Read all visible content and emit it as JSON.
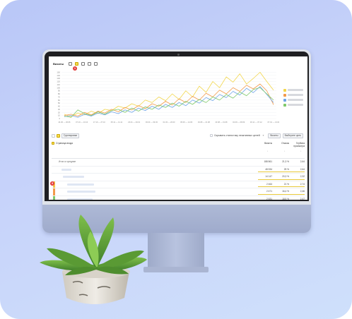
{
  "screen": {
    "title": "Визиты",
    "badge_chart": "1",
    "badge_table": "3",
    "controls": {
      "groupings": "Группировки",
      "hide_bots": "Скрывать статистику неактивных целей",
      "visits_btn": "Визиты",
      "choose_btn": "Выберите цель"
    },
    "table": {
      "dimension_header": "Страница входа",
      "metric_headers": [
        "Визиты",
        "Отказы",
        "Глубина просмотра"
      ],
      "sort_marks": [
        "↓",
        "↓",
        "↓"
      ],
      "totals_label": "Итого и средние",
      "totals": [
        "188 861",
        "21,3 %",
        "2,64"
      ],
      "rows": [
        {
          "values": [
            "48 534",
            "25 %",
            "2,64"
          ],
          "color": "#ffffff"
        },
        {
          "values": [
            "14 147",
            "20,3 %",
            "2,32"
          ],
          "color": "#ffffff"
        },
        {
          "values": [
            "2 464",
            "21 %",
            "2,74"
          ],
          "color": "#f2c84b"
        },
        {
          "values": [
            "2 471",
            "16,4 %",
            "2,46"
          ],
          "color": "#f29a4b"
        },
        {
          "values": [
            "2 631",
            "18,5 %",
            "2,47"
          ],
          "color": "#7fc96b"
        },
        {
          "values": [
            "1 720",
            "16,3 %",
            "2,47"
          ],
          "color": "#6fa4e8"
        }
      ]
    }
  },
  "chart_data": {
    "type": "line",
    "title": "",
    "xlabel": "",
    "ylabel": "",
    "ylim": [
      0,
      160
    ],
    "yticks": [
      0,
      10,
      20,
      30,
      40,
      50,
      60,
      70,
      80,
      90,
      100,
      110,
      120,
      130,
      140,
      150
    ],
    "x_labels": [
      "24.06 — 30.06",
      "07.10 — 13.10",
      "17.10 — 27.10",
      "05.11 — 11.11",
      "23.01 — 29.01",
      "03.03 — 09.03",
      "01.03 — 20.03",
      "05.06 — 14.06",
      "04.08 — 21.08",
      "23.08 — 31.08",
      "02.09 — 08.09",
      "30.11 — 07.12",
      "07.01 — 13.01"
    ],
    "series": [
      {
        "color": "#f2d64b",
        "values": [
          14,
          6,
          18,
          12,
          24,
          16,
          30,
          26,
          40,
          34,
          48,
          40,
          60,
          52,
          70,
          58,
          80,
          62,
          90,
          70,
          105,
          85,
          120,
          100,
          135,
          118,
          145,
          112,
          130,
          150,
          120,
          92
        ]
      },
      {
        "color": "#f29a4b",
        "values": [
          10,
          14,
          8,
          20,
          12,
          24,
          18,
          30,
          22,
          36,
          28,
          42,
          32,
          48,
          40,
          56,
          44,
          64,
          52,
          72,
          60,
          82,
          70,
          92,
          80,
          100,
          88,
          108,
          96,
          112,
          90,
          45
        ]
      },
      {
        "color": "#6fa4e8",
        "values": [
          6,
          10,
          4,
          14,
          8,
          18,
          12,
          22,
          16,
          28,
          20,
          34,
          26,
          40,
          30,
          46,
          36,
          52,
          42,
          60,
          50,
          68,
          58,
          78,
          68,
          88,
          76,
          98,
          84,
          104,
          78,
          52
        ]
      },
      {
        "color": "#7fc96b",
        "values": [
          8,
          4,
          28,
          16,
          10,
          22,
          14,
          26,
          30,
          20,
          34,
          24,
          38,
          30,
          44,
          36,
          50,
          40,
          56,
          46,
          62,
          52,
          70,
          60,
          78,
          66,
          86,
          74,
          94,
          100,
          80,
          60
        ]
      }
    ]
  }
}
